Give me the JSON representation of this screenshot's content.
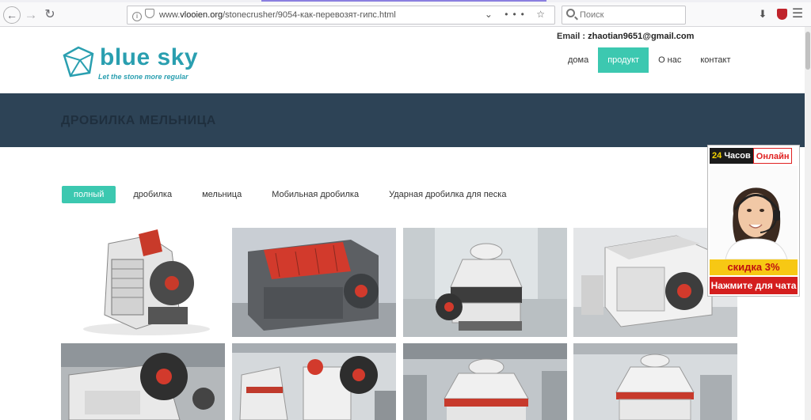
{
  "browser": {
    "url_prefix": "www.",
    "url_host": "vlooien.org",
    "url_path": "/stonecrusher/9054-как-перевозят-гипс.html",
    "search_placeholder": "Поиск",
    "overflow_label": "•••",
    "star_label": "☆",
    "dropdown_label": "⌄"
  },
  "header": {
    "email_label": "Email :",
    "email_address": "zhaotian9651@gmail.com",
    "logo_name": "blue sky",
    "logo_tagline": "Let the stone more regular",
    "nav": [
      {
        "label": "дома",
        "active": false
      },
      {
        "label": "продукт",
        "active": true
      },
      {
        "label": "О нас",
        "active": false
      },
      {
        "label": "контакт",
        "active": false
      }
    ]
  },
  "banner": {
    "title": "ДРОБИЛКА МЕЛЬНИЦА"
  },
  "filters": [
    {
      "label": "полный",
      "active": true
    },
    {
      "label": "дробилка",
      "active": false
    },
    {
      "label": "мельница",
      "active": false
    },
    {
      "label": "Мобильная дробилка",
      "active": false
    },
    {
      "label": "Ударная дробилка для песка",
      "active": false
    }
  ],
  "products": [
    {
      "name": "jaw-crusher-side"
    },
    {
      "name": "impact-crusher-open"
    },
    {
      "name": "cone-crusher"
    },
    {
      "name": "impact-crusher-workshop"
    },
    {
      "name": "jaw-crusher-flywheel"
    },
    {
      "name": "cone-and-jaw-crushers"
    },
    {
      "name": "cone-crusher-factory"
    },
    {
      "name": "cone-crusher-grey"
    }
  ],
  "chat": {
    "hours": "24",
    "hours_label": "Часов",
    "online_label": "Онлайн",
    "discount": "скидка 3%",
    "button": "Нажмите для чата"
  },
  "colors": {
    "accent": "#3cc8b0",
    "banner": "#2d4356",
    "logo": "#2a9fb0"
  }
}
